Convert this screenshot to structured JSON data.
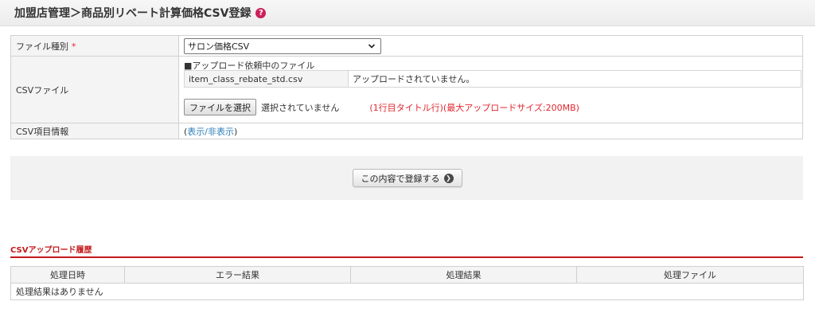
{
  "header": {
    "title": "加盟店管理＞商品別リベート計算価格CSV登録",
    "help_icon": "?"
  },
  "form": {
    "file_type": {
      "label": "ファイル種別",
      "required_mark": "*",
      "selected": "サロン価格CSV"
    },
    "csv_file": {
      "label": "CSVファイル",
      "pending_heading": "■アップロード依頼中のファイル",
      "pending_filename": "item_class_rebate_std.csv",
      "pending_status": "アップロードされていません。",
      "choose_button": "ファイルを選択",
      "no_file": "選択されていません",
      "note": "(1行目タイトル行)(最大アップロードサイズ:200MB)"
    },
    "csv_fields": {
      "label": "CSV項目情報",
      "paren_open": "(",
      "toggle_link": "表示/非表示",
      "paren_close": ")"
    }
  },
  "actions": {
    "submit_label": "この内容で登録する",
    "submit_icon": "❯"
  },
  "history": {
    "title": "CSVアップロード履歴",
    "columns": [
      "処理日時",
      "エラー結果",
      "処理結果",
      "処理ファイル"
    ],
    "empty_message": "処理結果はありません"
  },
  "colors": {
    "accent_red": "#c41a1a",
    "required_red": "#e0262e",
    "link_blue": "#2d7fb8",
    "help_pink": "#cc1f5a"
  }
}
